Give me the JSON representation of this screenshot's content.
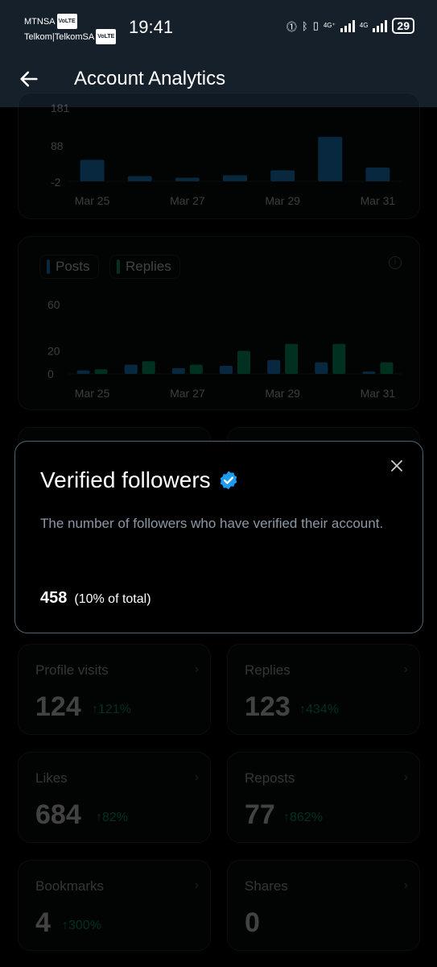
{
  "status_bar": {
    "carrier1": "MTNSA",
    "carrier2": "Telkom|TelkomSA",
    "volte": "VoLTE",
    "time": "19:41",
    "network1": "4G⁺",
    "network2": "4G",
    "battery": "29"
  },
  "header": {
    "title": "Account Analytics"
  },
  "chart_data": [
    {
      "type": "bar",
      "categories": [
        "Mar 25",
        "Mar 26",
        "Mar 27",
        "Mar 28",
        "Mar 29",
        "Mar 30",
        "Mar 31"
      ],
      "x_tick_labels": [
        "Mar 25",
        "Mar 27",
        "Mar 29",
        "Mar 31"
      ],
      "y_tick_labels": [
        "-2",
        "88",
        "181"
      ],
      "values": [
        53,
        13,
        9,
        15,
        27,
        110,
        34
      ],
      "ylim": [
        -2,
        181
      ],
      "colors": [
        "#1d9bf0"
      ]
    },
    {
      "type": "bar",
      "categories": [
        "Mar 25",
        "Mar 26",
        "Mar 27",
        "Mar 28",
        "Mar 29",
        "Mar 30",
        "Mar 31"
      ],
      "x_tick_labels": [
        "Mar 25",
        "Mar 27",
        "Mar 29",
        "Mar 31"
      ],
      "y_tick_labels": [
        "0",
        "20",
        "60"
      ],
      "series": [
        {
          "name": "Posts",
          "values": [
            3,
            8,
            5,
            7,
            12,
            10,
            2
          ]
        },
        {
          "name": "Replies",
          "values": [
            4,
            11,
            8,
            20,
            26,
            26,
            10
          ]
        }
      ],
      "ylim": [
        0,
        60
      ],
      "colors": [
        "#1d9bf0",
        "#00ba7c"
      ]
    }
  ],
  "modal": {
    "title": "Verified followers",
    "description": "The number of followers who have verified their account.",
    "value": "458",
    "percent": "(10% of total)"
  },
  "stats": [
    {
      "label": "Profile visits",
      "value": "124",
      "change": "↑121%"
    },
    {
      "label": "Replies",
      "value": "123",
      "change": "↑434%"
    },
    {
      "label": "Likes",
      "value": "684",
      "change": "↑82%"
    },
    {
      "label": "Reposts",
      "value": "77",
      "change": "↑862%"
    },
    {
      "label": "Bookmarks",
      "value": "4",
      "change": "↑300%"
    },
    {
      "label": "Shares",
      "value": "0",
      "change": ""
    }
  ],
  "colors": {
    "accent": "#1d9bf0",
    "positive": "#00ba7c",
    "header_bg": "#15202b"
  },
  "icons": {
    "back": "arrow-left-icon",
    "close": "close-icon",
    "verified": "verified-badge-icon",
    "info": "info-icon",
    "chevron": "chevron-right-icon"
  }
}
